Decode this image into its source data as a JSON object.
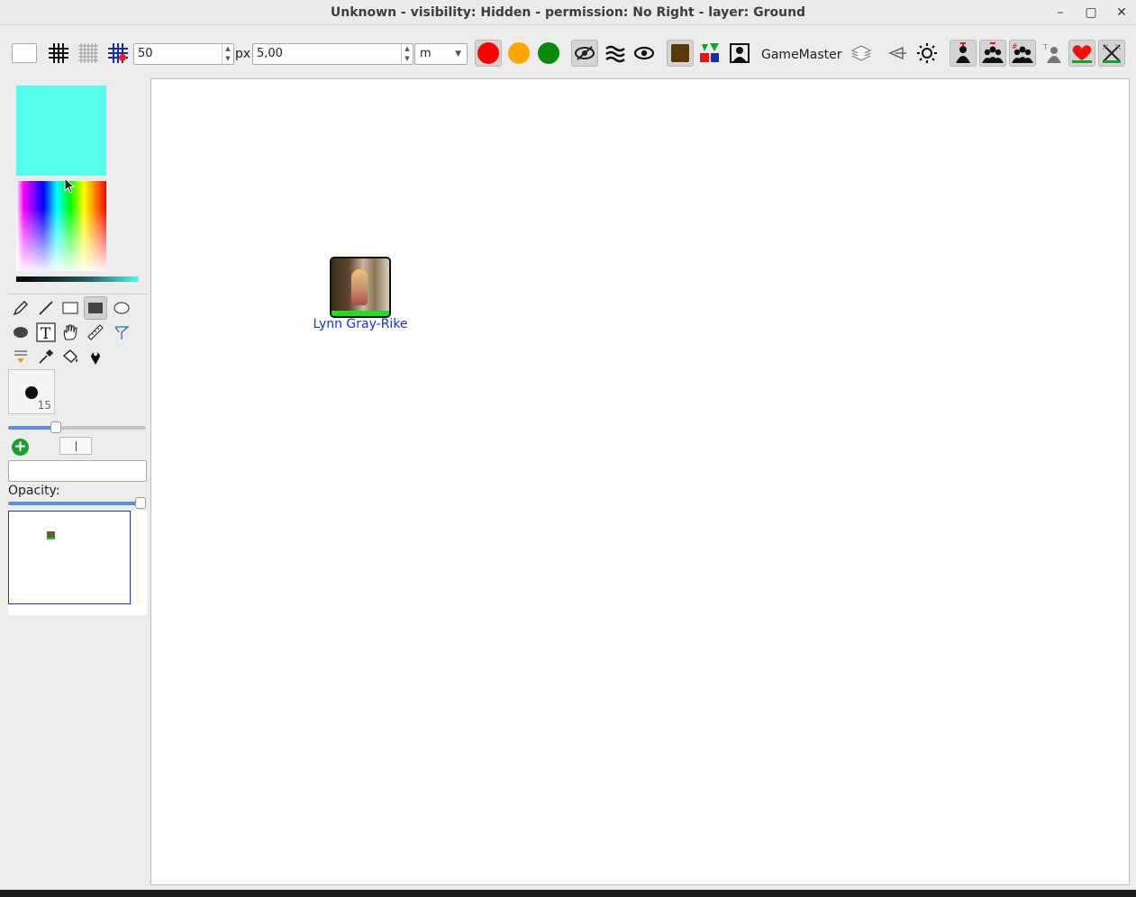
{
  "window": {
    "title": "Unknown - visibility: Hidden - permission: No Right - layer: Ground",
    "minimize": "–",
    "maximize": "▢",
    "close": "✕"
  },
  "toolbar": {
    "grid_size": "50",
    "grid_unit": "px",
    "scale_value": "5,00",
    "scale_unit": "m",
    "user_label": "GameMaster",
    "spin_up": "▲",
    "spin_down": "▼",
    "combo_arrow": "▼"
  },
  "colors": {
    "current": "#55fded",
    "red": "#ff0000",
    "orange": "#ffa500",
    "green": "#0a8a0a",
    "brown": "#5a3a00",
    "token_health": "#22dd22",
    "token_name": "#1532c9"
  },
  "brush": {
    "size": "15",
    "size_fraction": 0.33
  },
  "opacity": {
    "label": "Opacity:",
    "value_fraction": 1.0
  },
  "add_symbol": "+",
  "canvas": {
    "tokens": [
      {
        "name": "Lynn Gray-Rike"
      }
    ]
  }
}
